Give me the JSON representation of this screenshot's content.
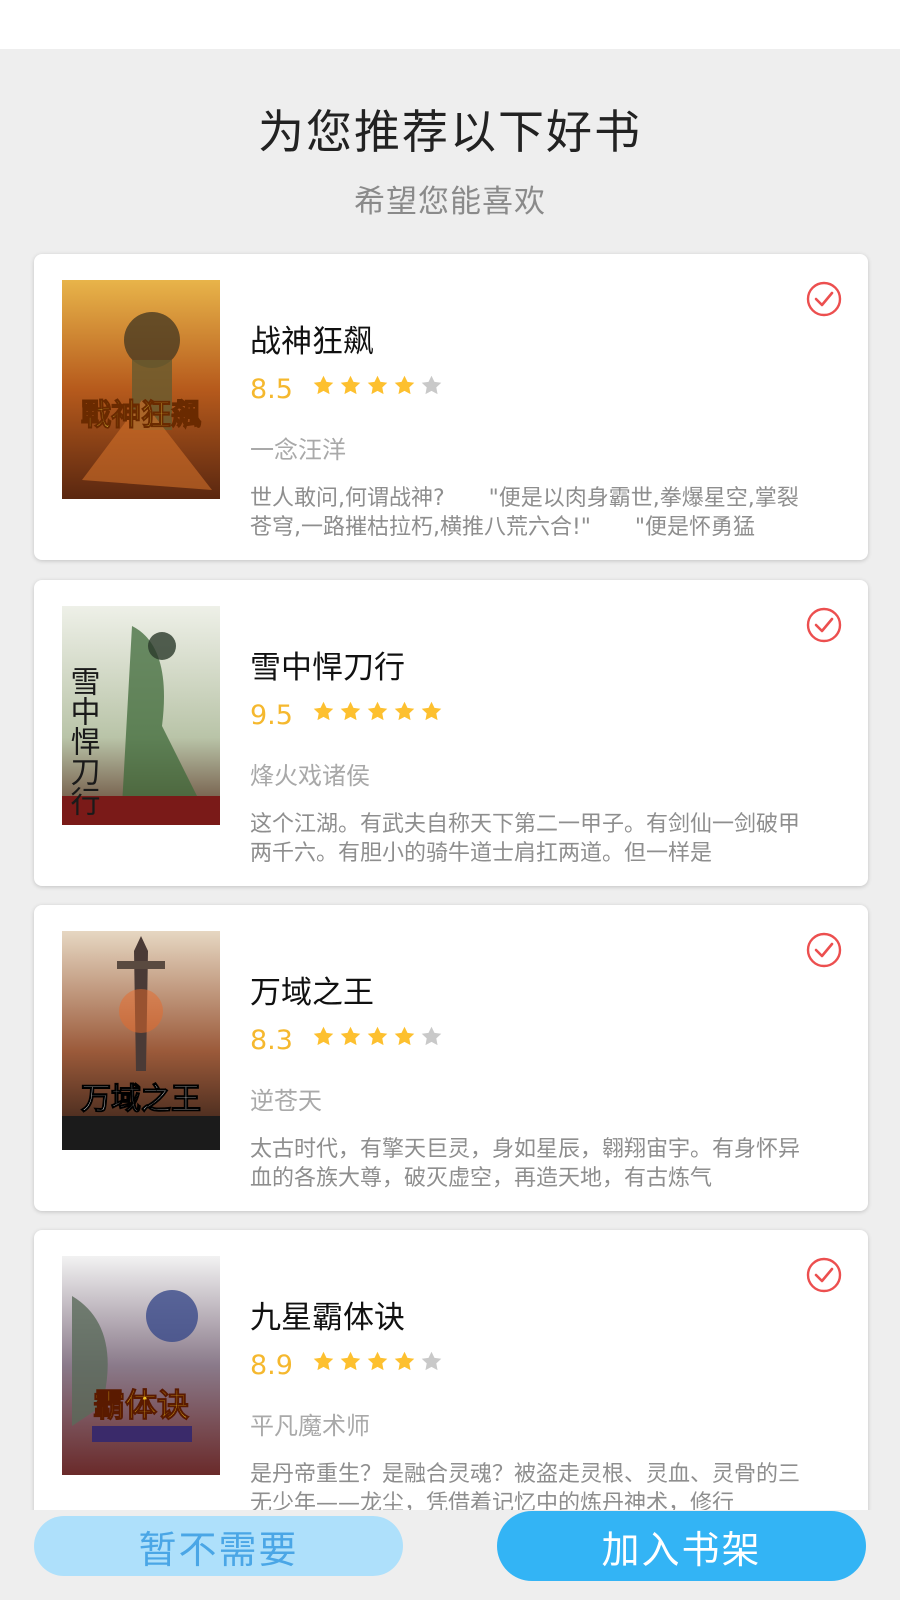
{
  "header": {
    "title": "为您推荐以下好书",
    "subtitle": "希望您能喜欢"
  },
  "colors": {
    "accent": "#33b4f5",
    "star": "#fdc02f",
    "check": "#ec4f4f",
    "score": "#f5b82e"
  },
  "books": [
    {
      "title": "战神狂飙",
      "score": "8.5",
      "stars": 4,
      "author": "一念汪洋",
      "description": "世人敢问,何谓战神?　　\"便是以肉身霸世,拳爆星空,掌裂苍穹,一路摧枯拉朽,横推八荒六合!\"　　\"便是怀勇猛",
      "selected": true,
      "cover_text": "戰神狂飆"
    },
    {
      "title": "雪中悍刀行",
      "score": "9.5",
      "stars": 5,
      "author": "烽火戏诸侯",
      "description": "这个江湖。有武夫自称天下第二一甲子。有剑仙一剑破甲两千六。有胆小的骑牛道士肩扛两道。但一样是",
      "selected": true,
      "cover_text": "雪中悍刀行"
    },
    {
      "title": "万域之王",
      "score": "8.3",
      "stars": 4,
      "author": "逆苍天",
      "description": "太古时代，有擎天巨灵，身如星辰，翱翔宙宇。有身怀异血的各族大尊，破灭虚空，再造天地，有古炼气",
      "selected": true,
      "cover_text": "万域之王"
    },
    {
      "title": "九星霸体诀",
      "score": "8.9",
      "stars": 4,
      "author": "平凡魔术师",
      "description": "是丹帝重生？是融合灵魂？被盗走灵根、灵血、灵骨的三无少年——龙尘，凭借着记忆中的炼丹神术，修行",
      "selected": true,
      "cover_text": "霸体诀"
    }
  ],
  "actions": {
    "skip_label": "暂不需要",
    "add_label": "加入书架"
  }
}
